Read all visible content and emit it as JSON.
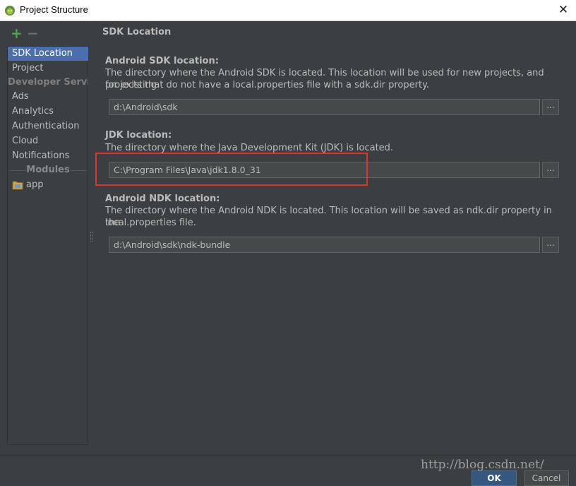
{
  "window": {
    "title": "Project Structure",
    "close_icon": "close-icon"
  },
  "toolbar": {
    "add_icon": "plus-icon",
    "remove_icon": "minus-icon"
  },
  "sidebar": {
    "items": [
      {
        "label": "SDK Location",
        "selected": true
      },
      {
        "label": "Project"
      },
      {
        "label": "Developer Services",
        "group": true
      },
      {
        "label": "Ads"
      },
      {
        "label": "Analytics"
      },
      {
        "label": "Authentication"
      },
      {
        "label": "Cloud"
      },
      {
        "label": "Notifications"
      }
    ],
    "modules_header": "Modules",
    "modules": [
      {
        "label": "app",
        "icon": "module-folder-icon"
      }
    ]
  },
  "main": {
    "section_title": "SDK Location",
    "android_sdk": {
      "label": "Android SDK location:",
      "desc_line1": "The directory where the Android SDK is located. This location will be used for new projects, and for existing",
      "desc_line2": "projects that do not have a local.properties file with a sdk.dir property.",
      "value": "d:\\Android\\sdk",
      "browse": "..."
    },
    "jdk": {
      "label": "JDK location:",
      "desc_line1": "The directory where the Java Development Kit (JDK) is located.",
      "value": "C:\\Program Files\\Java\\jdk1.8.0_31",
      "browse": "..."
    },
    "android_ndk": {
      "label": "Android NDK location:",
      "desc_line1": "The directory where the Android NDK is located. This location will be saved as ndk.dir property in the",
      "desc_line2": "local.properties file.",
      "value": "d:\\Android\\sdk\\ndk-bundle",
      "browse": "..."
    }
  },
  "footer": {
    "watermark": "http://blog.csdn.net/",
    "ok_label": "OK",
    "cancel_label": "Cancel"
  },
  "colors": {
    "background": "#3c3f41",
    "selection": "#4b6eaf",
    "highlight_box": "#e2302c",
    "accent_green": "#4ca64c"
  }
}
